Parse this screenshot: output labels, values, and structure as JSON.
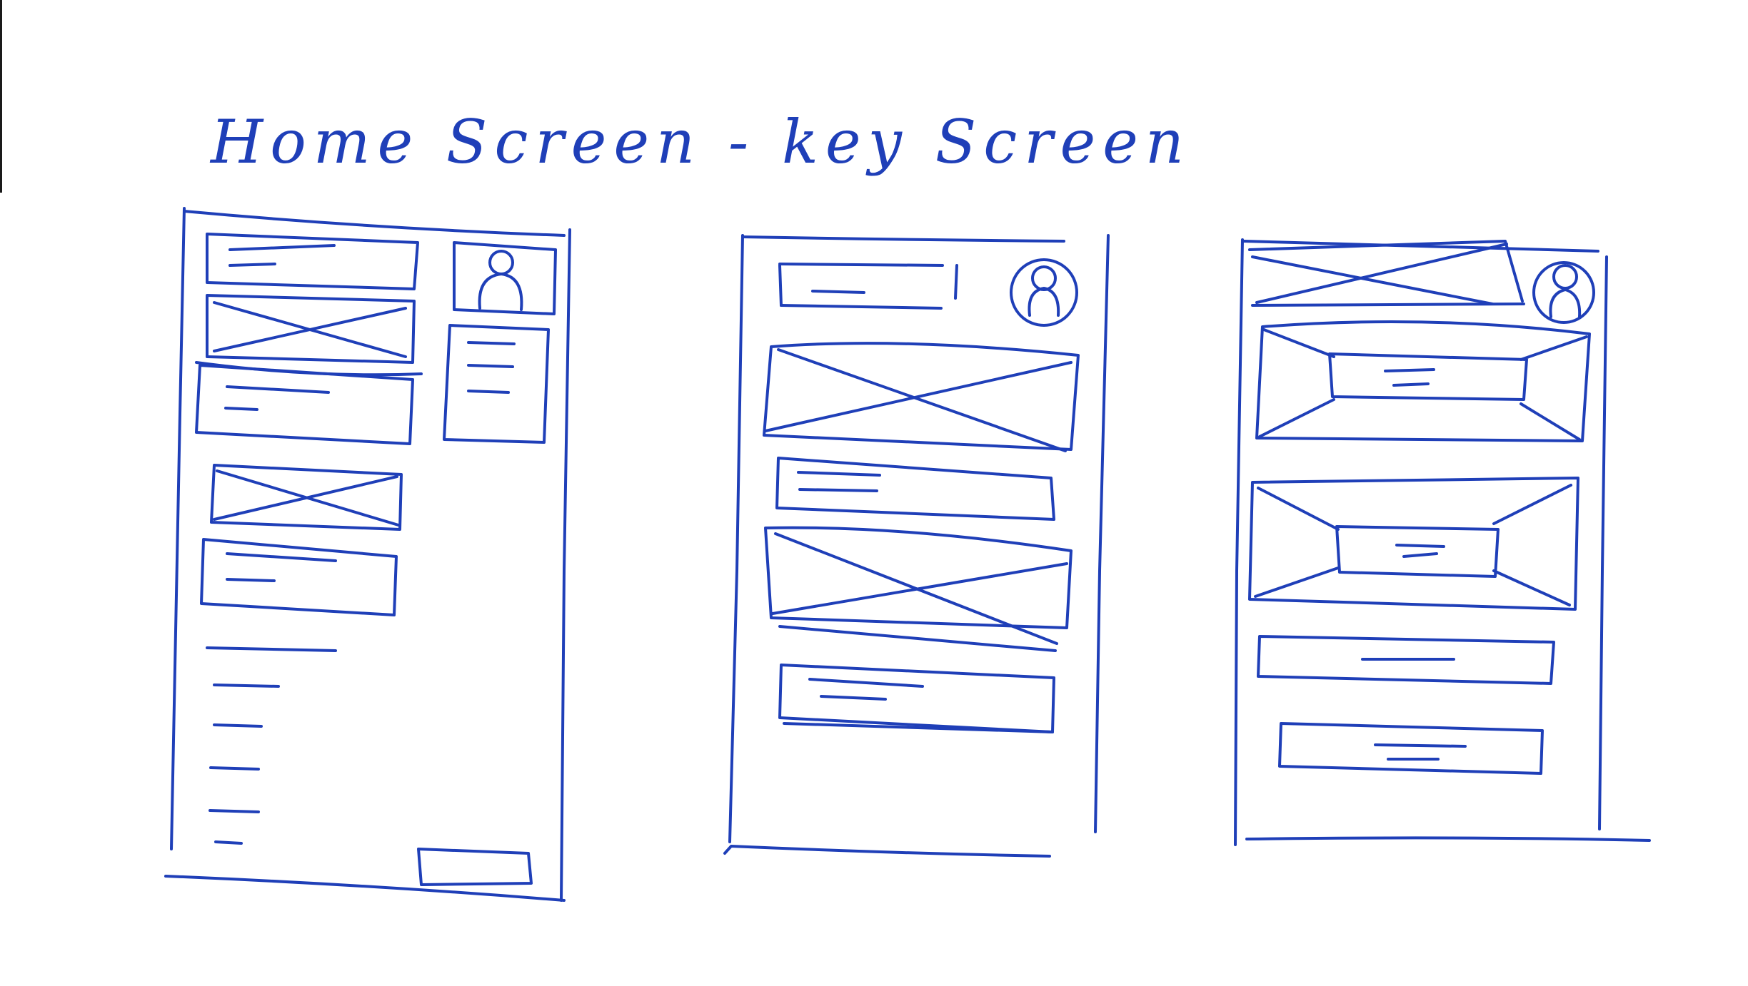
{
  "heading": "Home Screen - key Screen",
  "ink_color": "#1f3fb8",
  "paper_color": "#ffffff",
  "icons": {
    "avatar": "user-avatar-icon",
    "image_placeholder": "crossed-box-placeholder-icon"
  },
  "wireframes": [
    {
      "id": "home-screen-sketch-1",
      "elements": [
        "text-card",
        "profile-avatar",
        "image-placeholder",
        "text-card",
        "side-menu",
        "image-placeholder",
        "text-card",
        "menu-list",
        "bottom-button"
      ]
    },
    {
      "id": "home-screen-sketch-2",
      "elements": [
        "header-bar",
        "profile-avatar",
        "image-placeholder",
        "text-card",
        "image-placeholder",
        "text-card"
      ]
    },
    {
      "id": "home-screen-sketch-3",
      "elements": [
        "header-image",
        "profile-avatar",
        "banner-with-label",
        "banner-with-label",
        "text-card",
        "text-card"
      ]
    }
  ]
}
